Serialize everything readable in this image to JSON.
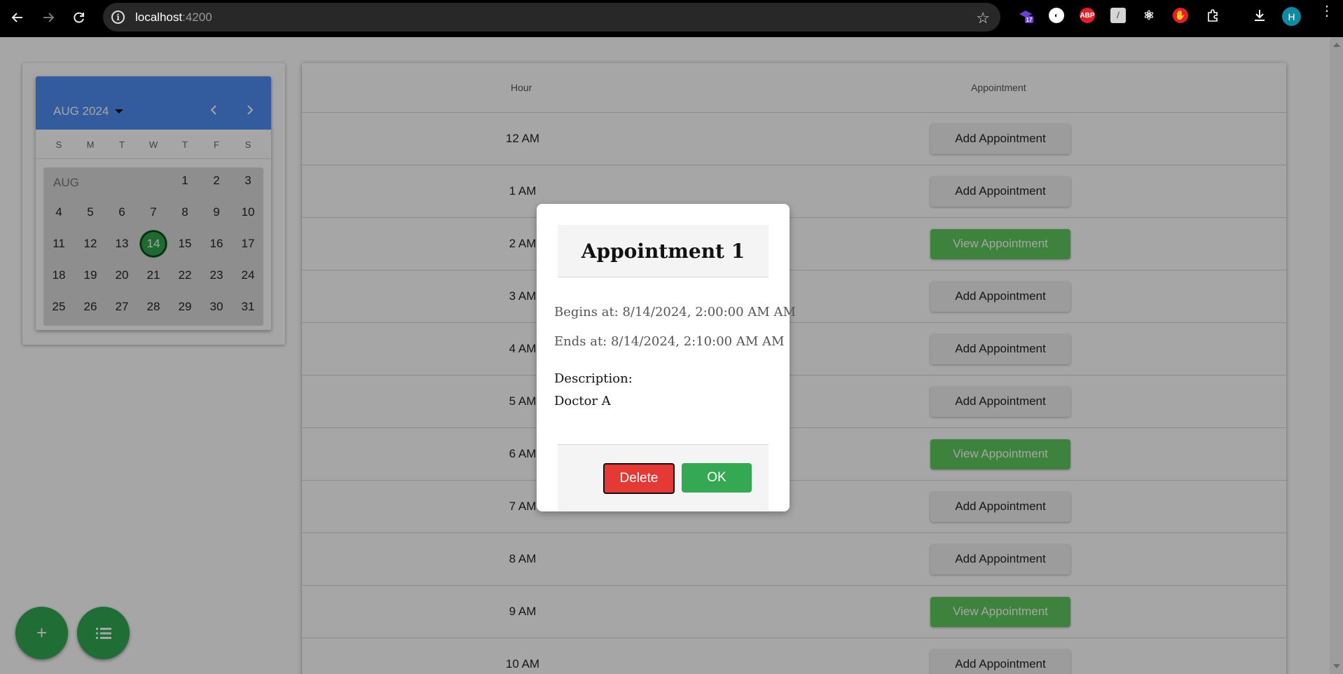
{
  "browser": {
    "url_host": "localhost",
    "url_port": ":4200",
    "extension_badge": "17",
    "abp_label": "ABP",
    "profile_initial": "H"
  },
  "calendar": {
    "month_label": "AUG 2024",
    "grid_month_label": "AUG",
    "weekdays": [
      "S",
      "M",
      "T",
      "W",
      "T",
      "F",
      "S"
    ],
    "selected_day": 14,
    "weeks": [
      [
        "",
        "",
        "",
        "",
        "1",
        "2",
        "3"
      ],
      [
        "4",
        "5",
        "6",
        "7",
        "8",
        "9",
        "10"
      ],
      [
        "11",
        "12",
        "13",
        "14",
        "15",
        "16",
        "17"
      ],
      [
        "18",
        "19",
        "20",
        "21",
        "22",
        "23",
        "24"
      ],
      [
        "25",
        "26",
        "27",
        "28",
        "29",
        "30",
        "31"
      ]
    ]
  },
  "table": {
    "col_hour": "Hour",
    "col_appointment": "Appointment",
    "rows": [
      {
        "hour": "12 AM",
        "action": "Add Appointment",
        "type": "add"
      },
      {
        "hour": "1 AM",
        "action": "Add Appointment",
        "type": "add"
      },
      {
        "hour": "2 AM",
        "action": "View Appointment",
        "type": "view"
      },
      {
        "hour": "3 AM",
        "action": "Add Appointment",
        "type": "add"
      },
      {
        "hour": "4 AM",
        "action": "Add Appointment",
        "type": "add"
      },
      {
        "hour": "5 AM",
        "action": "Add Appointment",
        "type": "add"
      },
      {
        "hour": "6 AM",
        "action": "View Appointment",
        "type": "view"
      },
      {
        "hour": "7 AM",
        "action": "Add Appointment",
        "type": "add"
      },
      {
        "hour": "8 AM",
        "action": "Add Appointment",
        "type": "add"
      },
      {
        "hour": "9 AM",
        "action": "View Appointment",
        "type": "view"
      },
      {
        "hour": "10 AM",
        "action": "Add Appointment",
        "type": "add"
      }
    ]
  },
  "fabs": {
    "add_symbol": "+"
  },
  "modal": {
    "title": "Appointment 1",
    "begins": "Begins at: 8/14/2024, 2:00:00 AM AM",
    "ends": "Ends at: 8/14/2024, 2:10:00 AM AM",
    "description_label": "Description:",
    "description_value": "Doctor A",
    "delete_label": "Delete",
    "ok_label": "OK"
  },
  "colors": {
    "accent_green": "#34a853",
    "calendar_header": "#4e8ef2",
    "delete_red": "#e53935"
  }
}
